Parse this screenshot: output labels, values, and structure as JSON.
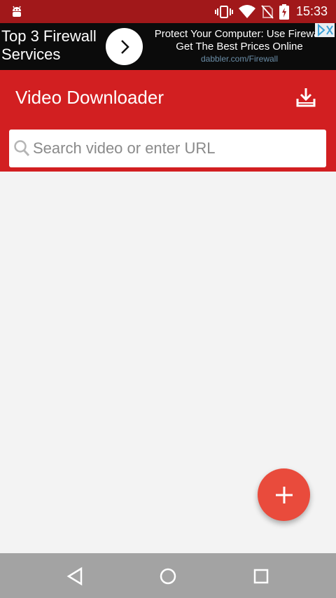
{
  "status_bar": {
    "time": "15:33",
    "icons": [
      "android-debug-icon",
      "vibrate-icon",
      "wifi-icon",
      "no-sim-icon",
      "battery-charging-icon"
    ]
  },
  "ad": {
    "left_text_line1": "Top 3 Firewall",
    "left_text_line2": "Services",
    "headline": "Protect Your Computer: Use Firewall",
    "subline": "Get The Best Prices Online",
    "domain": "dabbler.com/Firewall",
    "icons": [
      "chevron-right-icon",
      "ad-choices-icon"
    ]
  },
  "app_bar": {
    "title": "Video Downloader",
    "icons": [
      "download-icon"
    ]
  },
  "search": {
    "placeholder": "Search video or enter URL",
    "value": "",
    "icon": "search-icon"
  },
  "fab": {
    "icon": "plus-icon"
  },
  "nav_bar": {
    "icons": [
      "back-icon",
      "home-icon",
      "recents-icon"
    ]
  },
  "colors": {
    "status_bar": "#a1181a",
    "app_bar": "#d21f21",
    "fab": "#e94b3c",
    "background": "#f3f3f3",
    "nav_bar": "#a3a3a3"
  }
}
